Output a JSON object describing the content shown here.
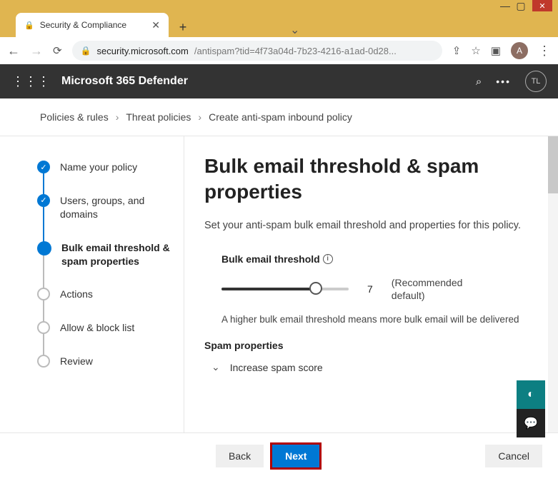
{
  "window": {
    "tab_title": "Security & Compliance",
    "url_domain": "security.microsoft.com",
    "url_path": "/antispam?tid=4f73a04d-7b23-4216-a1ad-0d28...",
    "avatar_letter": "A"
  },
  "header": {
    "title": "Microsoft 365 Defender",
    "user_initials": "TL"
  },
  "breadcrumb": {
    "items": [
      "Policies & rules",
      "Threat policies",
      "Create anti-spam inbound policy"
    ]
  },
  "steps": {
    "items": [
      {
        "label": "Name your policy",
        "state": "done"
      },
      {
        "label": "Users, groups, and domains",
        "state": "done"
      },
      {
        "label": "Bulk email threshold & spam properties",
        "state": "current"
      },
      {
        "label": "Actions",
        "state": "todo"
      },
      {
        "label": "Allow & block list",
        "state": "todo"
      },
      {
        "label": "Review",
        "state": "todo"
      }
    ]
  },
  "main": {
    "heading": "Bulk email threshold & spam properties",
    "subtext": "Set your anti-spam bulk email threshold and properties for this policy.",
    "slider": {
      "label": "Bulk email threshold",
      "value": "7",
      "recommended": "(Recommended default)"
    },
    "help_text": "A higher bulk email threshold means more bulk email will be delivered",
    "section_title": "Spam properties",
    "expander_label": "Increase spam score"
  },
  "footer": {
    "back": "Back",
    "next": "Next",
    "cancel": "Cancel"
  }
}
